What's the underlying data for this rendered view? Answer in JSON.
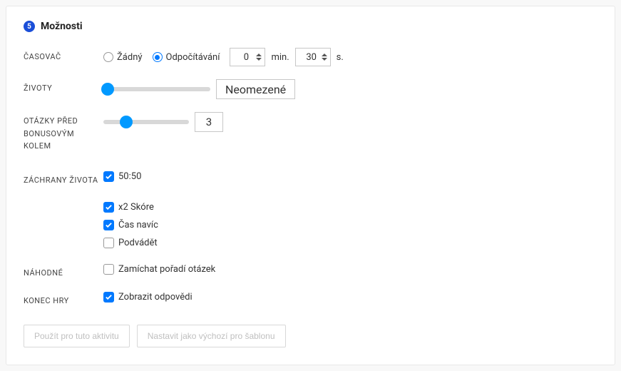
{
  "step": "5",
  "title": "Možnosti",
  "timer": {
    "label": "ČASOVAČ",
    "none_label": "Žádný",
    "countdown_label": "Odpočítávání",
    "selected": "countdown",
    "minutes": "0",
    "minutes_unit": "min.",
    "seconds": "30",
    "seconds_unit": "s."
  },
  "lives": {
    "label": "ŽIVOTY",
    "value_label": "Neomezené",
    "slider_pos_pct": 4
  },
  "bonus_round": {
    "label": "OTÁZKY PŘED BONUSOVÝM KOLEM",
    "value": "3",
    "slider_pos_pct": 27
  },
  "lifelines": {
    "label": "ZÁCHRANY ŽIVOTA",
    "items": [
      {
        "key": "fifty",
        "label": "50:50",
        "checked": true
      },
      {
        "key": "x2",
        "label": "x2 Skóre",
        "checked": true
      },
      {
        "key": "extratime",
        "label": "Čas navíc",
        "checked": true
      },
      {
        "key": "cheat",
        "label": "Podvádět",
        "checked": false
      }
    ]
  },
  "random": {
    "label": "NÁHODNÉ",
    "shuffle_label": "Zamíchat pořadí otázek",
    "shuffle_checked": false
  },
  "game_over": {
    "label": "KONEC HRY",
    "show_answers_label": "Zobrazit odpovědi",
    "show_answers_checked": true
  },
  "buttons": {
    "apply": "Použít pro tuto aktivitu",
    "set_default": "Nastavit jako výchozí pro šablonu"
  }
}
